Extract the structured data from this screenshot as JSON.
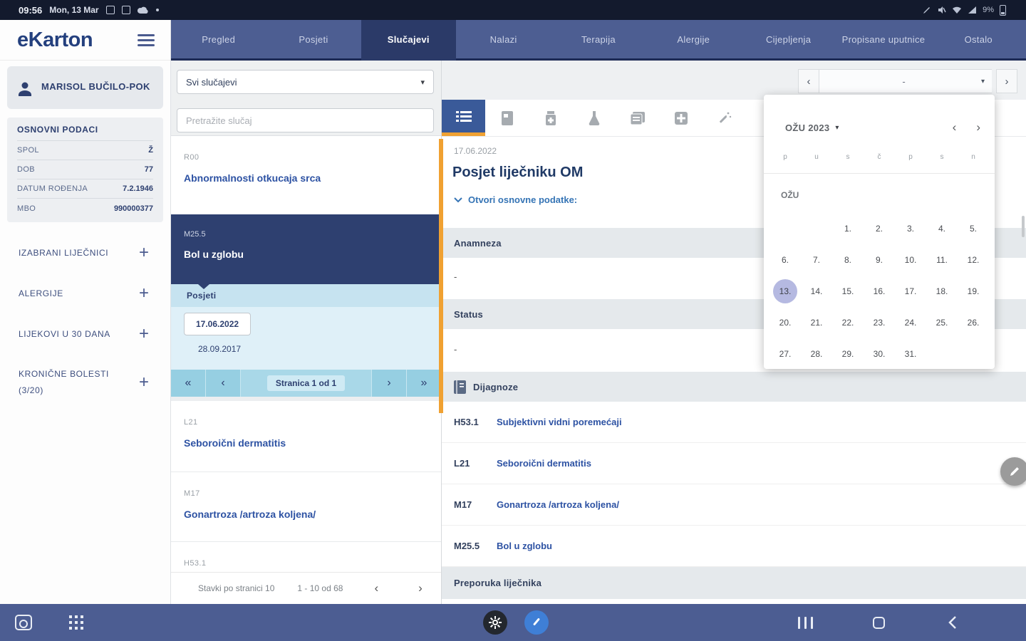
{
  "status_bar": {
    "time": "09:56",
    "date": "Mon, 13 Mar",
    "battery_percent": "9%"
  },
  "nav": {
    "logo": "eKarton",
    "tabs": [
      {
        "label": "Pregled",
        "active": false
      },
      {
        "label": "Posjeti",
        "active": false
      },
      {
        "label": "Slučajevi",
        "active": true
      },
      {
        "label": "Nalazi",
        "active": false
      },
      {
        "label": "Terapija",
        "active": false
      },
      {
        "label": "Alergije",
        "active": false
      },
      {
        "label": "Cijepljenja",
        "active": false
      },
      {
        "label": "Propisane uputnice",
        "active": false
      },
      {
        "label": "Ostalo",
        "active": false
      }
    ]
  },
  "sidebar": {
    "patient_name": "MARISOL BUČILO-POK",
    "basic_info_title": "OSNOVNI PODACI",
    "basic_info": [
      {
        "label": "SPOL",
        "value": "Ž"
      },
      {
        "label": "DOB",
        "value": "77"
      },
      {
        "label": "DATUM ROĐENJA",
        "value": "7.2.1946"
      },
      {
        "label": "MBO",
        "value": "990000377"
      }
    ],
    "sections": [
      {
        "label": "IZABRANI LIJEČNICI"
      },
      {
        "label": "ALERGIJE"
      },
      {
        "label": "LIJEKOVI U 30 DANA"
      },
      {
        "label": "KRONIČNE BOLESTI (3/20)"
      }
    ]
  },
  "case_list": {
    "filter_value": "Svi slučajevi",
    "search_placeholder": "Pretražite slučaj",
    "cases": [
      {
        "code": "R00",
        "name": "Abnormalnosti otkucaja srca"
      },
      {
        "code": "L21",
        "name": "Seboroični dermatitis"
      },
      {
        "code": "M17",
        "name": "Gonartroza /artroza koljena/"
      },
      {
        "code": "H53.1",
        "name": ""
      }
    ],
    "selected_case": {
      "code": "M25.5",
      "name": "Bol u zglobu"
    },
    "visits_label": "Posjeti",
    "visits": {
      "selected": "17.06.2022",
      "other": "28.09.2017"
    },
    "visit_pagination": "Stranica 1 od 1",
    "footer": {
      "items_per_page": "Stavki po stranici 10",
      "range": "1 - 10 od 68"
    }
  },
  "detail": {
    "date_nav_value": "-",
    "date": "17.06.2022",
    "title": "Posjet liječniku OM",
    "expand_link": "Otvori osnovne podatke:",
    "anamneza_title": "Anamneza",
    "anamneza_content": "-",
    "status_title": "Status",
    "status_content": "-",
    "diagnoses_title": "Dijagnoze",
    "diagnoses": [
      {
        "code": "H53.1",
        "name": "Subjektivni vidni poremećaji"
      },
      {
        "code": "L21",
        "name": "Seboroični dermatitis"
      },
      {
        "code": "M17",
        "name": "Gonartroza /artroza koljena/"
      },
      {
        "code": "M25.5",
        "name": "Bol u zglobu"
      }
    ],
    "recommendation_title": "Preporuka liječnika"
  },
  "calendar": {
    "header": "OŽU 2023",
    "weekdays": [
      "p",
      "u",
      "s",
      "č",
      "p",
      "s",
      "n"
    ],
    "month_label": "OŽU",
    "selected_day": "13.",
    "weeks": [
      [
        "",
        "",
        "1.",
        "2.",
        "3.",
        "4.",
        "5."
      ],
      [
        "6.",
        "7.",
        "8.",
        "9.",
        "10.",
        "11.",
        "12."
      ],
      [
        "13.",
        "14.",
        "15.",
        "16.",
        "17.",
        "18.",
        "19."
      ],
      [
        "20.",
        "21.",
        "22.",
        "23.",
        "24.",
        "25.",
        "26."
      ],
      [
        "27.",
        "28.",
        "29.",
        "30.",
        "31.",
        "",
        ""
      ]
    ]
  },
  "icons": {
    "first": "«",
    "prev": "‹",
    "next": "›",
    "last": "»",
    "caret": "▾"
  },
  "colors": {
    "accent_orange": "#f0a132",
    "navy": "#2e4070",
    "navbar": "#4d5e92",
    "calendar_selected": "#b5b9e1"
  }
}
